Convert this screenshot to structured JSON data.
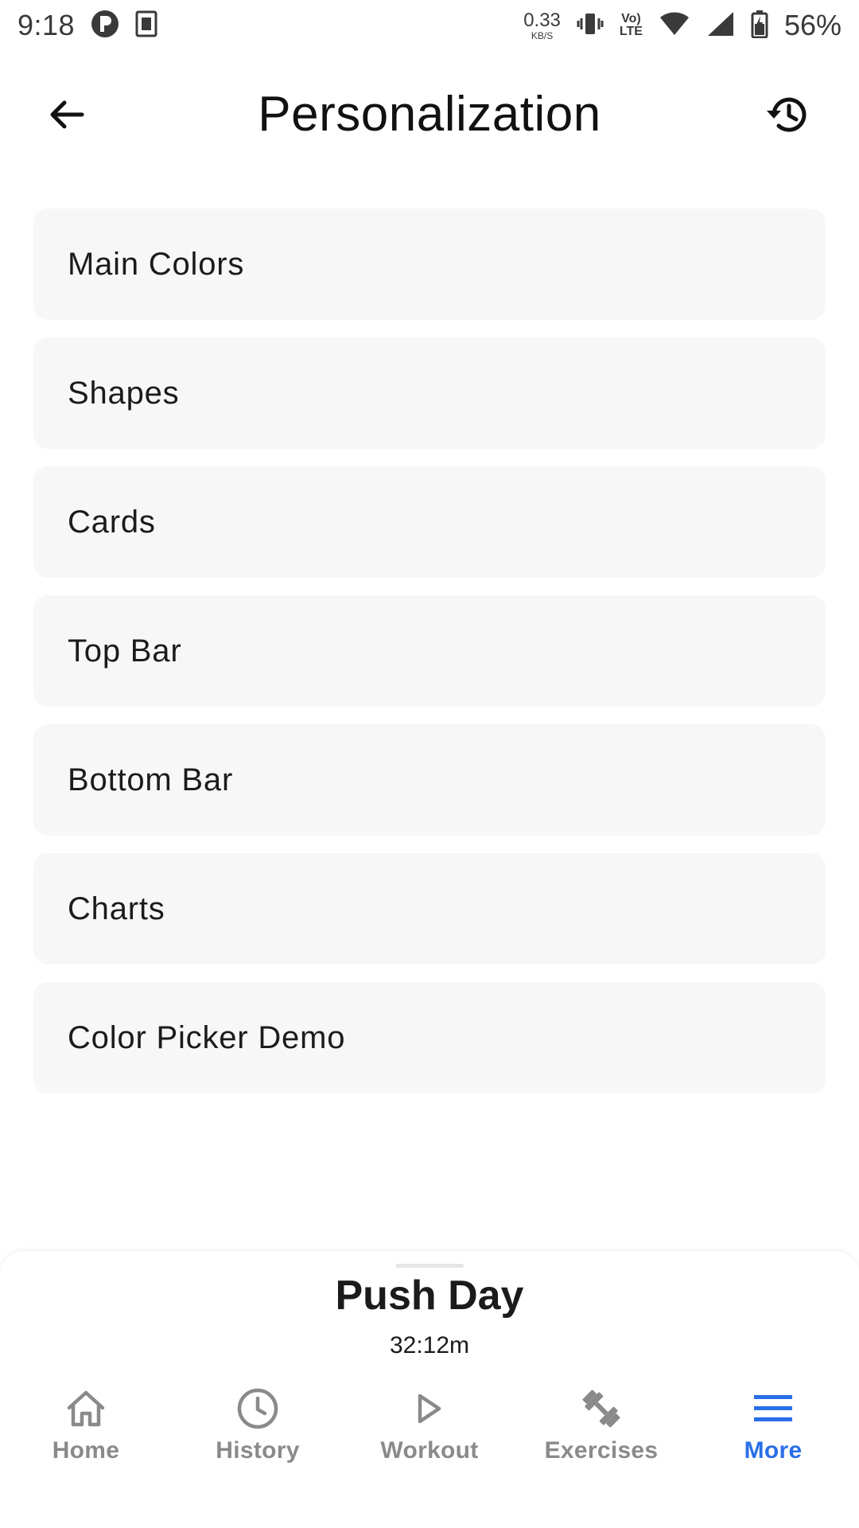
{
  "status_bar": {
    "time": "9:18",
    "net_speed": "0.33",
    "net_unit": "KB/S",
    "lte_top": "Vo)",
    "lte_bottom": "LTE",
    "battery_percent": "56%"
  },
  "top_bar": {
    "title": "Personalization",
    "back_icon": "arrow-back-icon",
    "action_icon": "history-icon"
  },
  "menu": {
    "items": [
      {
        "label": "Main Colors"
      },
      {
        "label": "Shapes"
      },
      {
        "label": "Cards"
      },
      {
        "label": "Top Bar"
      },
      {
        "label": "Bottom Bar"
      },
      {
        "label": "Charts"
      },
      {
        "label": "Color Picker Demo"
      }
    ]
  },
  "workout_panel": {
    "name": "Push Day",
    "elapsed": "32:12m"
  },
  "bottom_nav": {
    "items": [
      {
        "label": "Home",
        "icon": "home-icon",
        "active": false
      },
      {
        "label": "History",
        "icon": "clock-icon",
        "active": false
      },
      {
        "label": "Workout",
        "icon": "play-icon",
        "active": false
      },
      {
        "label": "Exercises",
        "icon": "dumbbell-icon",
        "active": false
      },
      {
        "label": "More",
        "icon": "menu-icon",
        "active": true
      }
    ],
    "active_color": "#2a6ee8",
    "inactive_color": "#8a8a8a"
  },
  "colors": {
    "list_item_bg": "#f7f7f7",
    "background": "#ffffff"
  }
}
